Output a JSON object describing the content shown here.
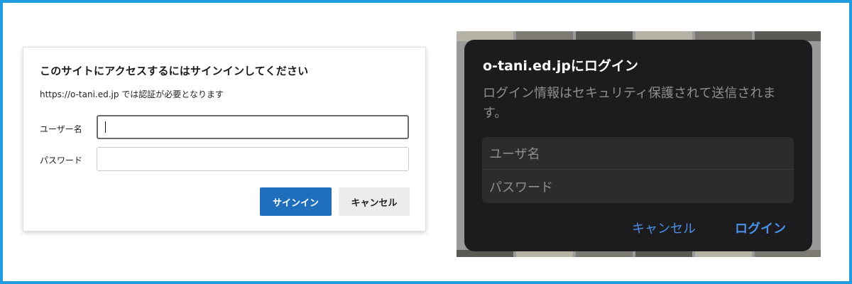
{
  "left_dialog": {
    "title": "このサイトにアクセスするにはサインインしてください",
    "description": "https://o-tani.ed.jp では認証が必要となります",
    "username_label": "ユーザー名",
    "password_label": "パスワード",
    "username_value": "",
    "password_value": "",
    "signin_button": "サインイン",
    "cancel_button": "キャンセル",
    "accent_color": "#1f6fbd"
  },
  "right_dialog": {
    "title": "o-tani.ed.jpにログイン",
    "message": "ログイン情報はセキュリティ保護されて送信されます。",
    "username_placeholder": "ユーザ名",
    "password_placeholder": "パスワード",
    "cancel_button": "キャンセル",
    "login_button": "ログイン",
    "accent_color": "#4a8ee6"
  },
  "frame_color": "#1f9be0"
}
